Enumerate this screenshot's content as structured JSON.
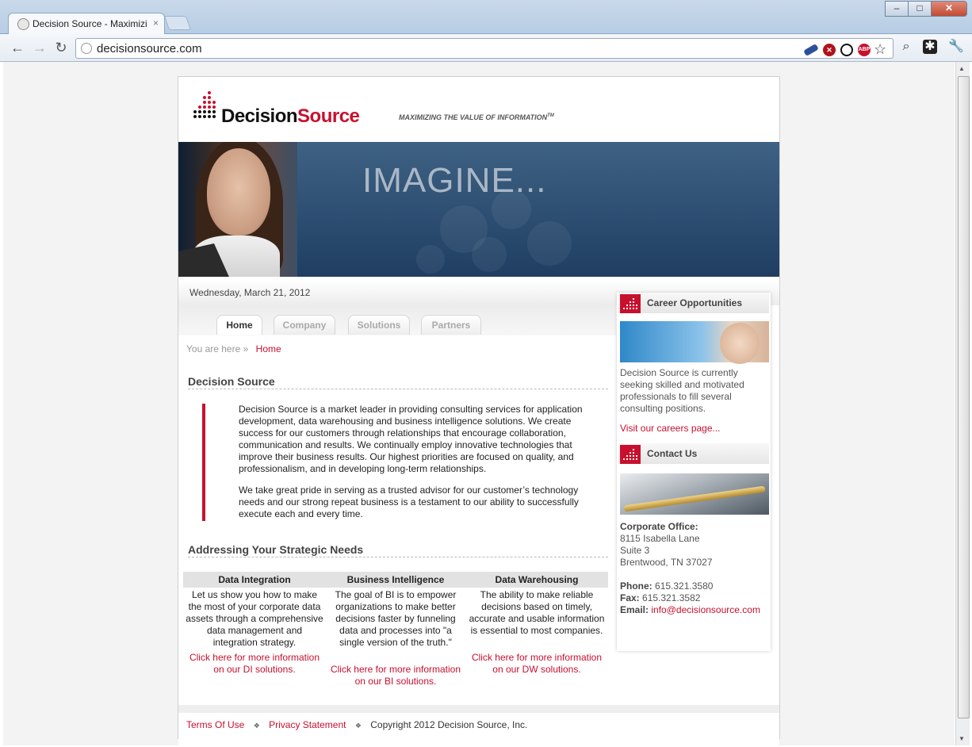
{
  "browser": {
    "tab_title": "Decision Source - Maximizi",
    "tab_close": "×",
    "url": "decisionsource.com",
    "window_buttons": [
      "–",
      "□",
      "✕"
    ],
    "nav_icons": [
      "back-icon",
      "forward-icon",
      "reload-icon"
    ],
    "extensions": [
      "eraser-extension-icon",
      "block-extension-icon",
      "refresh-extension-icon",
      "adblock-extension-icon"
    ],
    "abp_text": "ABP"
  },
  "site": {
    "logo_text_1": "Decision",
    "logo_text_2": "Source",
    "tagline": "MAXIMIZING THE VALUE OF INFORMATION",
    "tagline_tm": "TM",
    "banner_text": "IMAGINE...",
    "date": "Wednesday, March 21, 2012",
    "nav": [
      "Home",
      "Company",
      "Solutions",
      "Partners"
    ],
    "breadcrumb": {
      "prefix": "You are here",
      "arrow": "»",
      "current": "Home"
    },
    "intro": {
      "title": "Decision Source",
      "p1": "Decision Source is a market leader in providing consulting services for application development, data warehousing and business intelligence solutions. We create success for our customers through relationships that encourage collaboration, communication and results. We continually employ innovative technologies that improve their business results. Our highest priorities are focused on quality, and professionalism, and in developing long-term relationships.",
      "p2": "We take great pride in serving as a trusted advisor for our customer’s technology needs and our strong repeat business is a testament to our ability to successfully execute each and every time."
    },
    "needs": {
      "title": "Addressing Your Strategic Needs",
      "columns": [
        {
          "heading": "Data Integration",
          "body": "Let us show you how to make the most of your corporate data assets through a comprehensive data management and integration strategy.",
          "link": "Click here for more information on our DI solutions."
        },
        {
          "heading": "Business Intelligence",
          "body": "The goal of BI is to empower organizations to make better decisions faster by funneling data and processes into \"a single version of the truth.\"",
          "link": "Click here for more information on our BI solutions."
        },
        {
          "heading": "Data Warehousing",
          "body": "The ability to make reliable decisions based on timely, accurate and usable information is essential to most companies.",
          "link": "Click here for more information on our DW solutions."
        }
      ]
    },
    "sidebar": {
      "career_title": "Career Opportunities",
      "career_text": "Decision Source is currently seeking skilled and motivated professionals to fill several consulting positions.",
      "career_link": "Visit our careers page...",
      "contact_title": "Contact Us",
      "office_label": "Corporate Office:",
      "address_1": "8115 Isabella Lane",
      "address_2": "Suite 3",
      "address_3": "Brentwood, TN 37027",
      "phone_label": "Phone:",
      "phone": "615.321.3580",
      "fax_label": "Fax:",
      "fax": "615.321.3582",
      "email_label": "Email:",
      "email": "info@decisionsource.com"
    },
    "footer": {
      "terms": "Terms Of Use",
      "privacy": "Privacy Statement",
      "copyright": "Copyright 2012 Decision Source, Inc.",
      "separator": "❖"
    }
  },
  "colors": {
    "brand_red": "#c8102e",
    "banner_blue": "#2b4a6e"
  }
}
